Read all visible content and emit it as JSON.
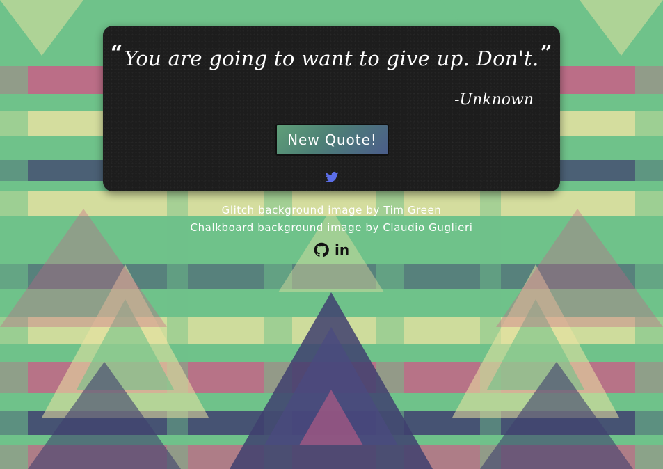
{
  "quote": {
    "text": "You are going to want to give up. Don't.",
    "open_mark": "“",
    "close_mark": "”",
    "author": "-Unknown"
  },
  "buttons": {
    "new_quote_label": "New Quote!",
    "tweet_icon": "twitter-icon"
  },
  "credits": {
    "line1_prefix": "Glitch background image by ",
    "line1_link": "Tim Green",
    "line2_prefix": "Chalkboard background image by ",
    "line2_link": "Claudio Guglieri"
  },
  "social": {
    "github_icon": "github-icon",
    "linkedin_icon": "linkedin-icon",
    "linkedin_text": "in"
  },
  "colors": {
    "background_green": "#6fc28a",
    "background_pink": "#c95f86",
    "background_navy": "#3f3f6e",
    "background_cream": "#ede4a2",
    "board": "#1d1d1d",
    "twitter_blue": "#5b6ee8",
    "button_green": "#5f9f78",
    "button_blue": "#4b5d8a"
  }
}
